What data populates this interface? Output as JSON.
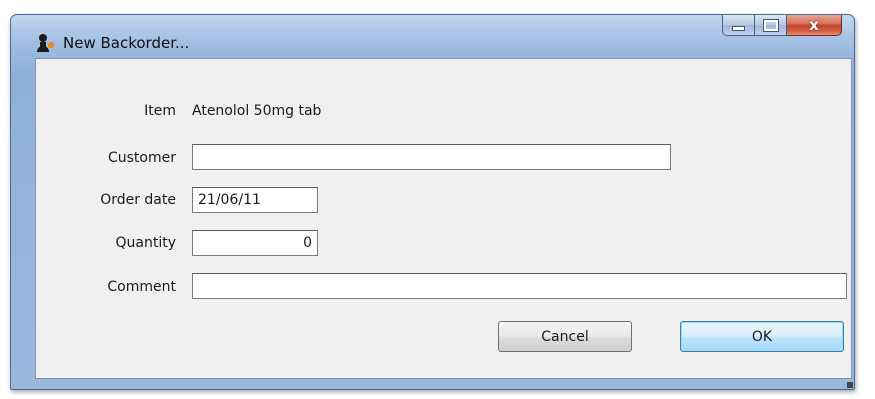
{
  "window": {
    "title": "New Backorder...",
    "icon": "mSupply-person-icon"
  },
  "caption": {
    "minimize": "minimize",
    "maximize": "maximize",
    "close": "x"
  },
  "form": {
    "item_label": "Item",
    "item_value": "Atenolol 50mg tab",
    "customer_label": "Customer",
    "customer_value": "",
    "order_date_label": "Order date",
    "order_date_value": "21/06/11",
    "quantity_label": "Quantity",
    "quantity_value": "0",
    "comment_label": "Comment",
    "comment_value": ""
  },
  "buttons": {
    "cancel": "Cancel",
    "ok": "OK"
  },
  "colors": {
    "client_bg": "#f0f0f0",
    "title_bar": "#a9c4e5",
    "close_red": "#c0432a",
    "ok_blue": "#3c7fb1"
  }
}
